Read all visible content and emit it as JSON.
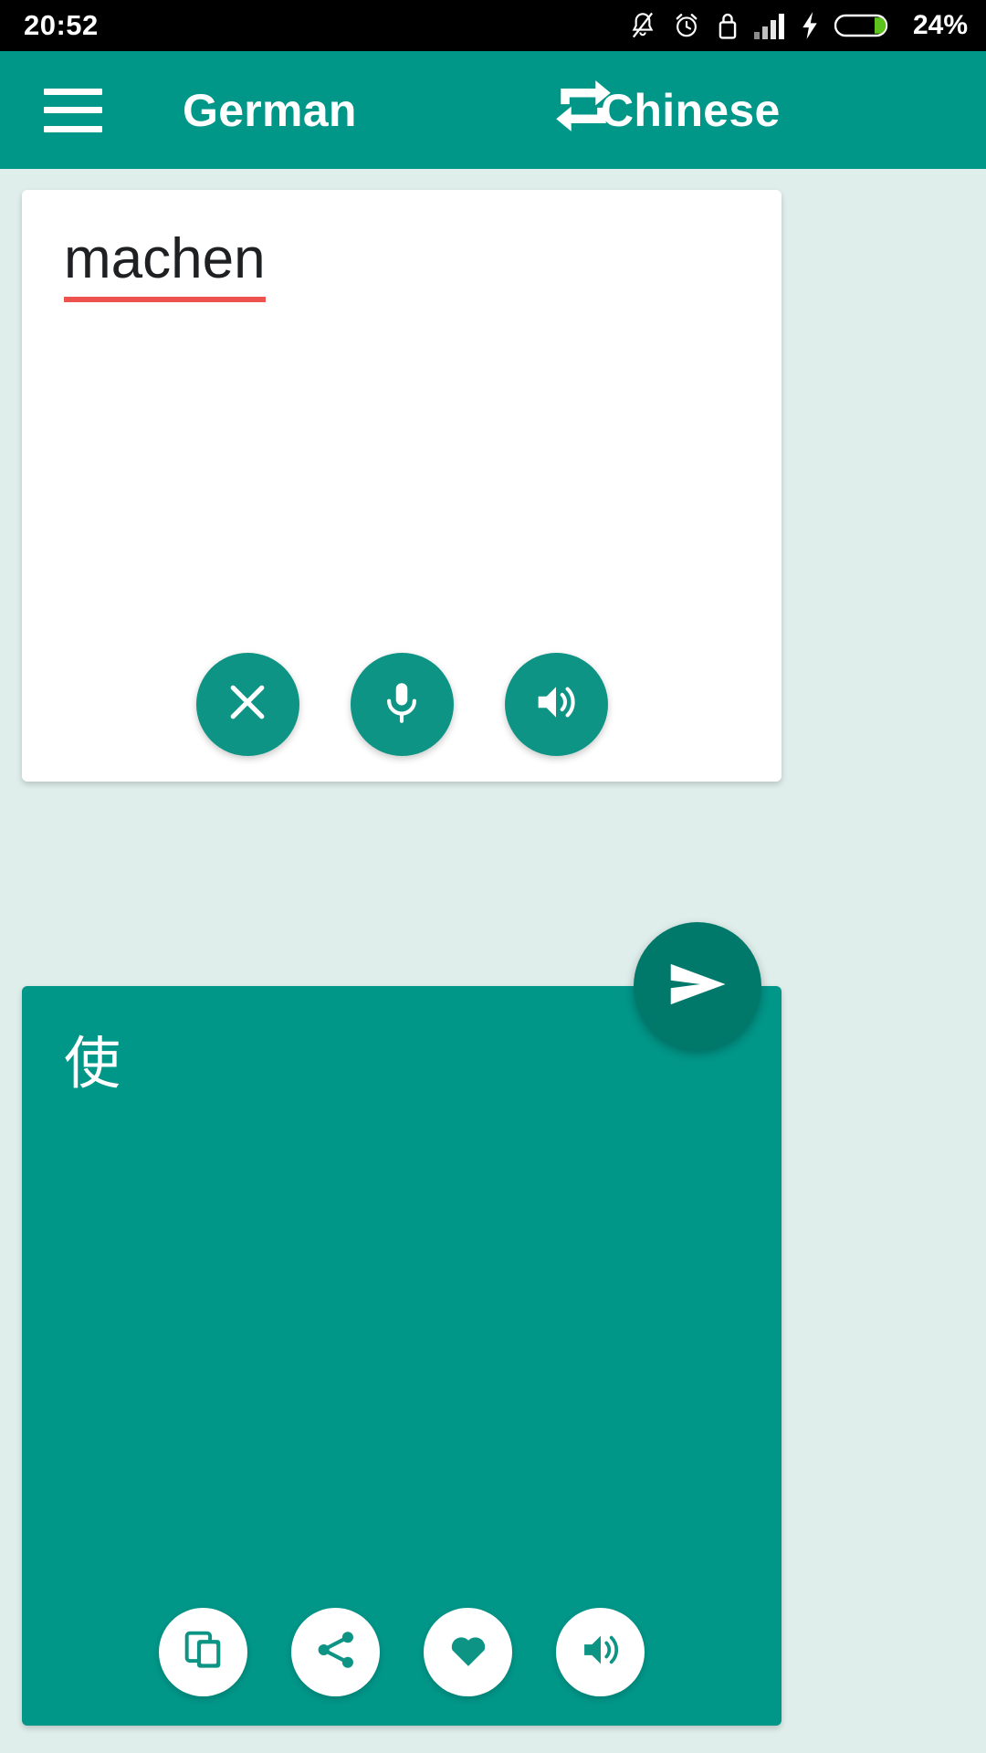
{
  "status_bar": {
    "time": "20:52",
    "battery_percent": "24%",
    "icons": [
      "bell-off-icon",
      "alarm-clock-icon",
      "lock-icon",
      "signal-bars-icon",
      "charging-bolt-icon",
      "battery-icon"
    ],
    "background_color": "#000000",
    "battery_fill_color": "#5DC21E"
  },
  "header": {
    "menu_label": "menu",
    "source_language": "German",
    "target_language": "Chinese",
    "swap_label": "swap languages",
    "background_color": "#009688"
  },
  "source_card": {
    "text": "machen",
    "spellcheck_underline_color": "#EF5350",
    "background_color": "#FFFFFF",
    "buttons": [
      {
        "name": "clear-button",
        "icon": "close-icon",
        "label": "Clear"
      },
      {
        "name": "voice-input-button",
        "icon": "microphone-icon",
        "label": "Speak"
      },
      {
        "name": "listen-source-button",
        "icon": "speaker-icon",
        "label": "Listen"
      }
    ]
  },
  "send_button": {
    "icon": "send-icon",
    "label": "Translate",
    "color": "#00796B"
  },
  "target_card": {
    "text": "使",
    "background_color": "#009688",
    "buttons": [
      {
        "name": "copy-button",
        "icon": "copy-icon",
        "label": "Copy"
      },
      {
        "name": "share-button",
        "icon": "share-icon",
        "label": "Share"
      },
      {
        "name": "favorite-button",
        "icon": "heart-icon",
        "label": "Favorite"
      },
      {
        "name": "listen-target-button",
        "icon": "speaker-icon",
        "label": "Listen"
      }
    ]
  },
  "page": {
    "background_color": "#DFEEEB"
  }
}
